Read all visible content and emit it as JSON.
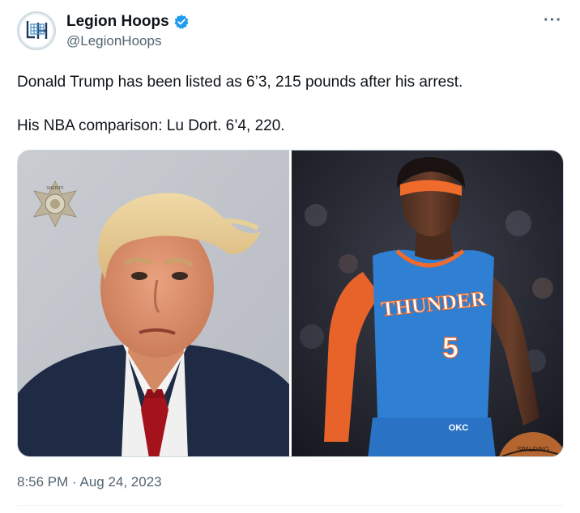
{
  "author": {
    "display_name": "Legion Hoops",
    "handle": "@LegionHoops",
    "verified": true,
    "avatar_icon": "legion-hoops-logo-icon"
  },
  "more_label": "···",
  "tweet": {
    "line1": "Donald Trump has been listed as 6’3, 215 pounds after his arrest.",
    "line2": "His NBA comparison: Lu Dort. 6’4, 220."
  },
  "media": {
    "left_photo": "mugshot photo of Donald Trump",
    "right_photo": "photo of Lu Dort in Thunder jersey",
    "badge_text": "SHERIFF",
    "jersey_team": "THUNDER",
    "jersey_number": "5",
    "shorts_text": "OKC",
    "ball_text": "SPALDING"
  },
  "timestamp": "8:56 PM · Aug 24, 2023",
  "colors": {
    "verified": "#1d9bf0",
    "secondary_text": "#536471",
    "jersey_blue": "#2f7fd3",
    "jersey_orange": "#ef6b2b"
  }
}
